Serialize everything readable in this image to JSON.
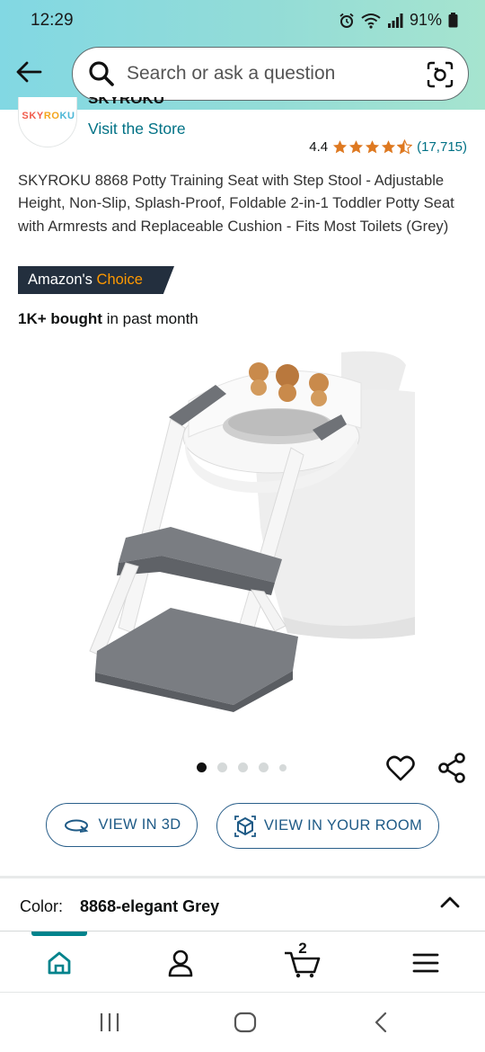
{
  "status_bar": {
    "time": "12:29",
    "battery": "91%"
  },
  "search": {
    "placeholder": "Search or ask a question"
  },
  "store": {
    "name": "SKYROKU",
    "logo_text_1": "SKY",
    "logo_text_2": "RO",
    "logo_text_3": "KU",
    "visit_label": "Visit the Store"
  },
  "rating": {
    "value": "4.4",
    "stars_filled": 4.4,
    "count": "(17,715)"
  },
  "product": {
    "title": "SKYROKU 8868 Potty Training Seat with Step Stool - Adjustable Height, Non-Slip, Splash-Proof, Foldable 2-in-1 Toddler Potty Seat with Armrests and Replaceable Cushion - Fits Most Toilets (Grey)",
    "badge_prefix": "Amazon's",
    "badge_suffix": "Choice",
    "bought_bold": "1K+ bought",
    "bought_rest": " in past month"
  },
  "gallery": {
    "image_count": 5,
    "active_index": 0
  },
  "buttons": {
    "view_3d": "VIEW IN 3D",
    "view_room": "VIEW IN YOUR ROOM"
  },
  "color": {
    "label": "Color:",
    "value": "8868-elegant Grey"
  },
  "bottom_nav": {
    "items": [
      "home-icon",
      "account-icon",
      "cart-icon",
      "menu-icon"
    ],
    "cart_count": "2"
  },
  "colors": {
    "accent_teal": "#00838c",
    "link": "#007185",
    "star": "#de7921",
    "badge_bg": "#232f3e",
    "badge_orange": "#ff9900",
    "button_blue": "#1e5a86"
  }
}
